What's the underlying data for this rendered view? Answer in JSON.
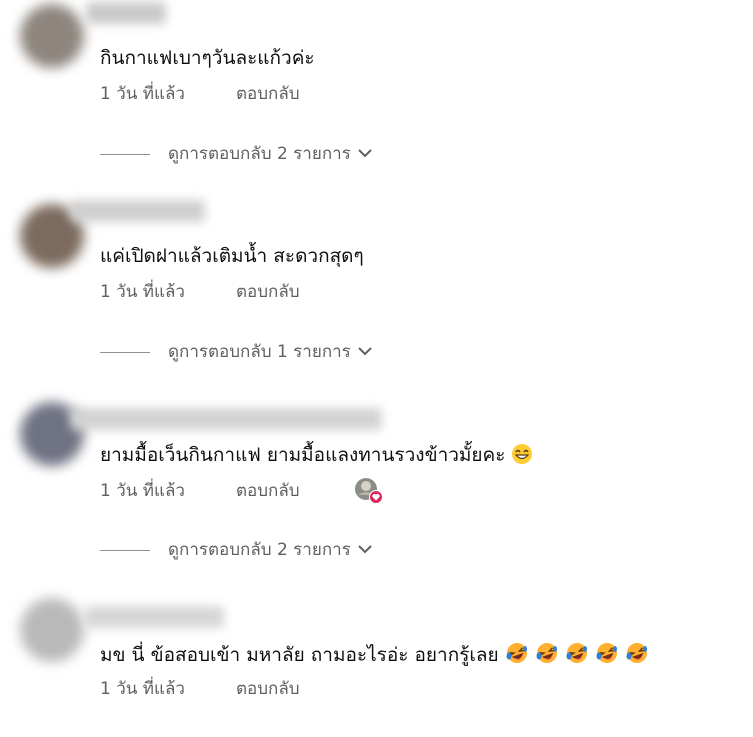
{
  "comments": [
    {
      "text": "กินกาแฟเบาๆวันละแก้วค่ะ",
      "time": "1 วัน ที่แล้ว",
      "reply_label": "ตอบกลับ",
      "replies_toggle": "ดูการตอบกลับ 2 รายการ"
    },
    {
      "text": "แค่เปิดฝาแล้วเติมน้ำ สะดวกสุดๆ",
      "time": "1 วัน ที่แล้ว",
      "reply_label": "ตอบกลับ",
      "replies_toggle": "ดูการตอบกลับ 1 รายการ"
    },
    {
      "text": "ยามมื้อเว็นกินกาแฟ ยามมื้อแลงทานรวงข้าวมั้ยคะ",
      "emoji": "grinning-face-emoji",
      "time": "1 วัน ที่แล้ว",
      "reply_label": "ตอบกลับ",
      "creator_heart": true,
      "replies_toggle": "ดูการตอบกลับ 2 รายการ"
    },
    {
      "text": "มข นี่ ข้อสอบเข้า มหาลัย ถามอะไรอ่ะ อยากรู้เลย",
      "emoji": "rolling-on-floor-laughing-emoji",
      "emoji_count": 5,
      "time": "1 วัน ที่แล้ว",
      "reply_label": "ตอบกลับ"
    }
  ],
  "colors": {
    "text_primary": "#0f0f0f",
    "text_secondary": "#606060",
    "heart_red": "#e0245e"
  }
}
